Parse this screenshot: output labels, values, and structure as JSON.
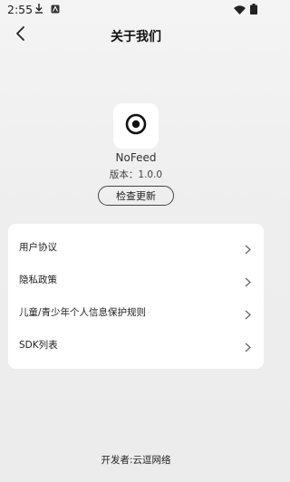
{
  "status_bar": {
    "time": "2:55",
    "icons": [
      "download-icon",
      "notification-icon",
      "wifi-icon",
      "battery-icon"
    ]
  },
  "header": {
    "back_icon": "chevron-left-icon",
    "title": "关于我们"
  },
  "app": {
    "logo_icon": "target-circle-icon",
    "name": "NoFeed",
    "version": "版本：1.0.0",
    "update_button_label": "检查更新"
  },
  "settings": {
    "items": [
      {
        "label": "用户协议",
        "icon": "chevron-right-icon"
      },
      {
        "label": "隐私政策",
        "icon": "chevron-right-icon"
      },
      {
        "label": "儿童/青少年个人信息保护规则",
        "icon": "chevron-right-icon"
      },
      {
        "label": "SDK列表",
        "icon": "chevron-right-icon"
      }
    ]
  },
  "footer": {
    "developer": "开发者:云逗网络"
  },
  "colors": {
    "background": "#efefef",
    "card": "#ffffff",
    "text": "#222222"
  }
}
